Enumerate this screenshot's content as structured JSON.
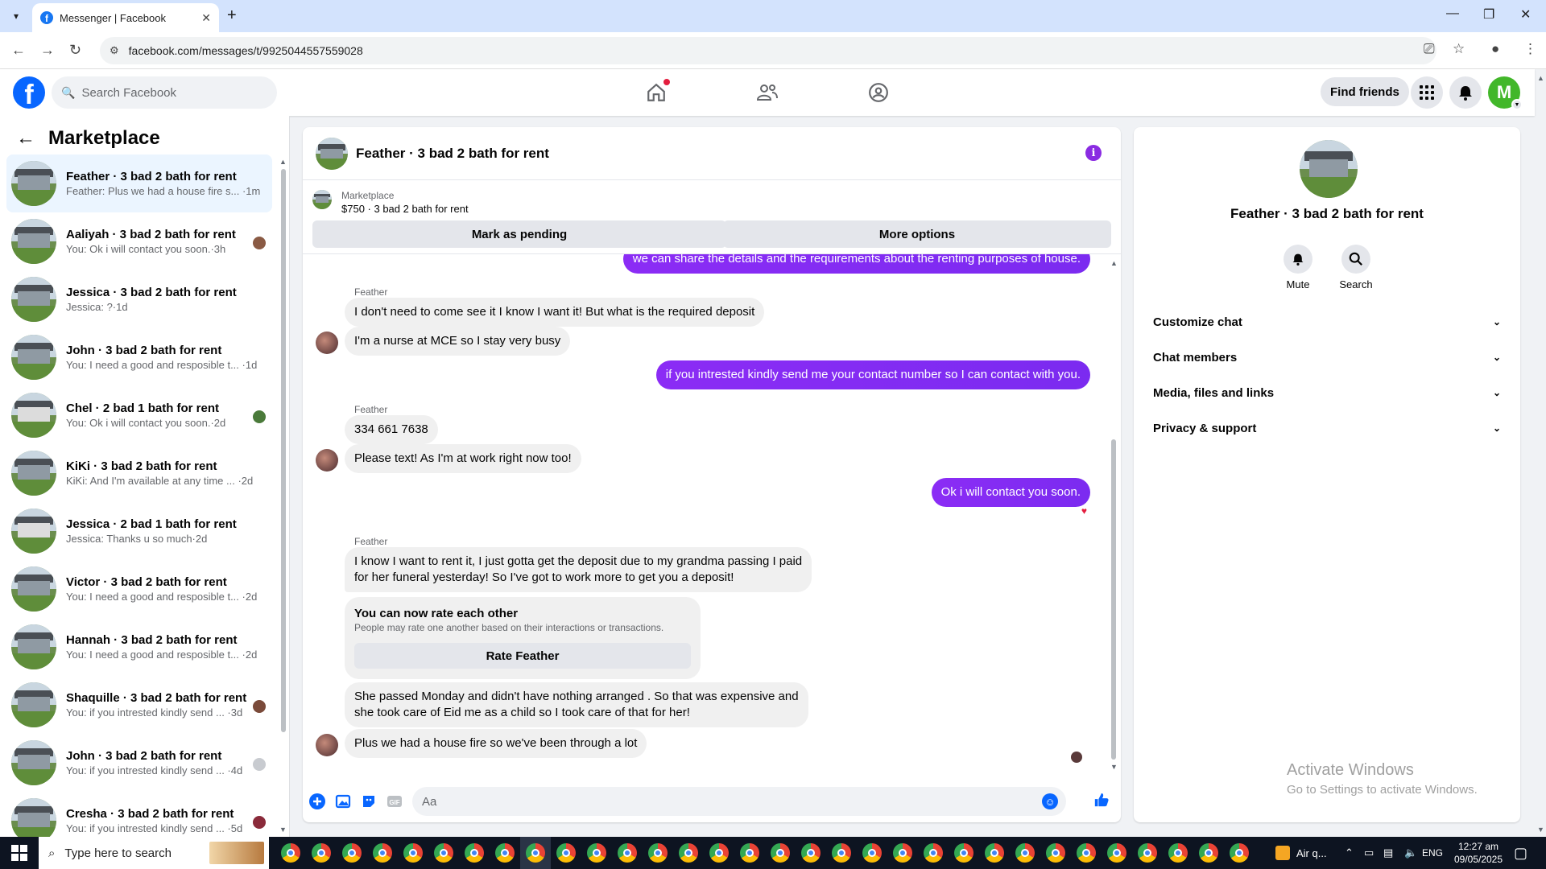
{
  "browser": {
    "tab_title": "Messenger | Facebook",
    "url": "facebook.com/messages/t/9925044557559028"
  },
  "header": {
    "search_placeholder": "Search Facebook",
    "find_friends": "Find friends",
    "avatar_letter": "M"
  },
  "sidebar": {
    "title": "Marketplace",
    "conversations": [
      {
        "name": "Feather · 3 bad 2 bath for rent",
        "preview": "Feather: Plus we had a house fire s... ·1m",
        "active": true
      },
      {
        "name": "Aaliyah · 3 bad 2 bath for rent",
        "preview": "You: Ok i will contact you soon.·3h"
      },
      {
        "name": "Jessica · 3 bad 2 bath for rent",
        "preview": "Jessica: ?·1d"
      },
      {
        "name": "John · 3 bad 2 bath for rent",
        "preview": "You: I need a good and resposible t... ·1d"
      },
      {
        "name": "Chel · 2 bad 1 bath for rent",
        "preview": "You: Ok i will contact you soon.·2d"
      },
      {
        "name": "KiKi · 3 bad 2 bath for rent",
        "preview": "KiKi: And I'm available at any time ... ·2d"
      },
      {
        "name": "Jessica · 2 bad 1 bath for rent",
        "preview": "Jessica: Thanks u so much·2d"
      },
      {
        "name": "Victor · 3 bad 2 bath for rent",
        "preview": "You: I need a good and resposible t... ·2d"
      },
      {
        "name": "Hannah · 3 bad 2 bath for rent",
        "preview": "You: I need a good and resposible t... ·2d"
      },
      {
        "name": "Shaquille · 3 bad 2 bath for rent",
        "preview": "You: if you intrested kindly send ... ·3d"
      },
      {
        "name": "John · 3 bad 2 bath for rent",
        "preview": "You: if you intrested kindly send ... ·4d"
      },
      {
        "name": "Cresha · 3 bad 2 bath for rent",
        "preview": "You: if you intrested kindly send ... ·5d"
      }
    ]
  },
  "chat": {
    "title": "Feather · 3 bad 2 bath for rent",
    "marketplace_label": "Marketplace",
    "listing": "$750 · 3 bad 2 bath for rent",
    "mark_pending": "Mark as pending",
    "more_options": "More options",
    "sender": "Feather",
    "messages": {
      "m0": "we can share the details and the requirements about the renting purposes of house.",
      "m1": "I don't need to come see it I know I want it! But what is the required deposit",
      "m2": "I'm a nurse at MCE so I stay very busy",
      "m3": "if you intrested kindly send me your contact number so I can contact with you.",
      "m4": "334 661 7638",
      "m5": "Please text! As I'm at work right now too!",
      "m6": "Ok i will contact you soon.",
      "m7a": "I know I want to rent it, I just gotta get the deposit due to my grandma passing I paid",
      "m7b": "for her funeral yesterday! So I've got to work more to get you a deposit!",
      "m8a": "She passed Monday and didn't have nothing arranged . So that was expensive and",
      "m8b": "she took care of Eid me as a child so I took care of that for her!",
      "m9": "Plus we had a house fire so we've been through a lot"
    },
    "rate": {
      "title": "You can now rate each other",
      "subtitle": "People may rate one another based on their interactions or transactions.",
      "button": "Rate Feather"
    },
    "composer_placeholder": "Aa"
  },
  "details": {
    "name": "Feather · 3 bad 2 bath for rent",
    "mute": "Mute",
    "search": "Search",
    "sections": [
      "Customize chat",
      "Chat members",
      "Media, files and links",
      "Privacy & support"
    ]
  },
  "watermark": {
    "line1": "Activate Windows",
    "line2": "Go to Settings to activate Windows."
  },
  "taskbar": {
    "search_placeholder": "Type here to search",
    "weather": "Air q...",
    "lang": "ENG",
    "time": "12:27 am",
    "date": "09/05/2025"
  },
  "colors": {
    "brand": "#0866ff",
    "outgoing_bubble": "#8b2cf5"
  }
}
